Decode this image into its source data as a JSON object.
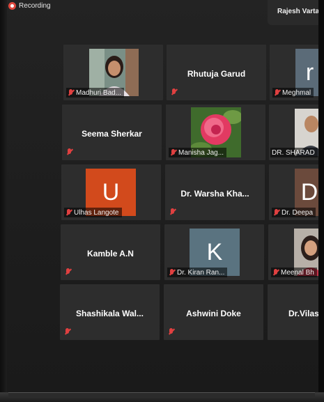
{
  "status": {
    "recording_label": "Recording"
  },
  "host": {
    "name": "Rajesh Varta"
  },
  "tiles": [
    {
      "name": "Madhuri Bad...",
      "mode": "tag"
    },
    {
      "name": "Rhutuja Garud",
      "mode": "center"
    },
    {
      "name": "Meghmal",
      "mode": "tag",
      "avatar_letter": "r",
      "color": "#5b6b78"
    },
    {
      "name": "Seema Sherkar",
      "mode": "center"
    },
    {
      "name": "Manisha Jag...",
      "mode": "tag"
    },
    {
      "name": "DR. SHARAD",
      "mode": "tag"
    },
    {
      "name": "Ulhas Langote",
      "mode": "tag",
      "avatar_letter": "U",
      "color": "#d24a1c"
    },
    {
      "name": "Dr. Warsha Kha...",
      "mode": "center"
    },
    {
      "name": "Dr. Deepa",
      "mode": "tag",
      "avatar_letter": "D",
      "color": "#6b4a3c"
    },
    {
      "name": "Kamble A.N",
      "mode": "center"
    },
    {
      "name": "Dr. Kiran Ran...",
      "mode": "tag",
      "avatar_letter": "K",
      "color": "#5a7380"
    },
    {
      "name": "Meenal Bh",
      "mode": "tag"
    },
    {
      "name": "Shashikala  Wal...",
      "mode": "center"
    },
    {
      "name": "Ashwini Doke",
      "mode": "center"
    },
    {
      "name": "Dr.Vilas",
      "mode": "center"
    }
  ]
}
